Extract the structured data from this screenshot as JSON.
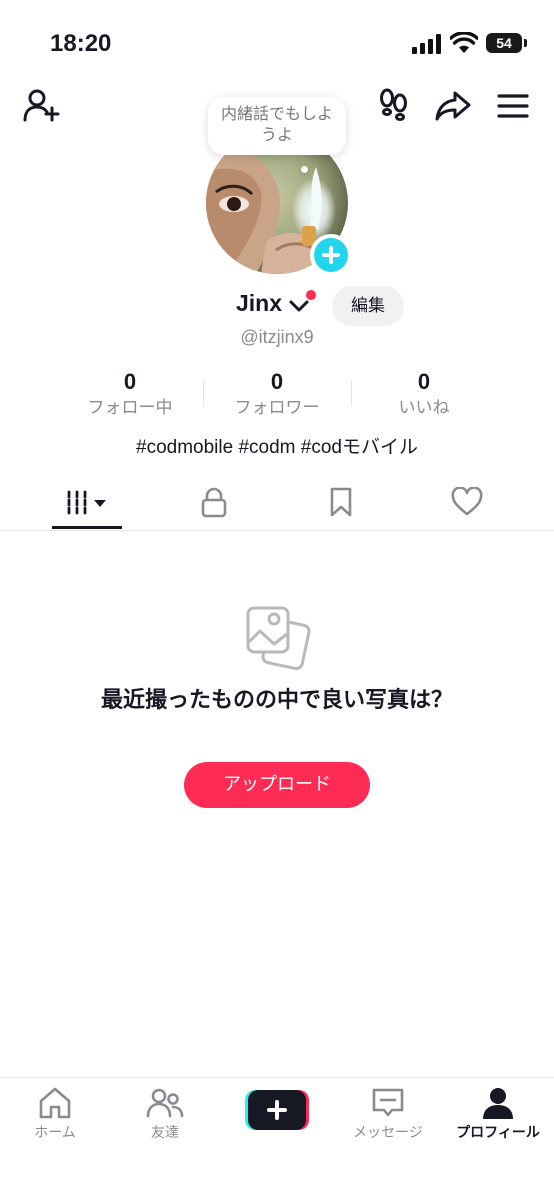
{
  "status_bar": {
    "time": "18:20",
    "battery": "54"
  },
  "header": {
    "note": "内緒話でもしようよ"
  },
  "profile": {
    "display_name": "Jinx",
    "username": "@itzjinx9",
    "edit_label": "編集",
    "bio": "#codmobile #codm #codモバイル"
  },
  "stats": [
    {
      "value": "0",
      "label": "フォロー中"
    },
    {
      "value": "0",
      "label": "フォロワー"
    },
    {
      "value": "0",
      "label": "いいね"
    }
  ],
  "tabs": [
    {
      "name": "videos",
      "icon": "grid-icon",
      "active": true
    },
    {
      "name": "private",
      "icon": "lock-icon"
    },
    {
      "name": "saved",
      "icon": "bookmark-icon"
    },
    {
      "name": "liked",
      "icon": "heart-icon"
    }
  ],
  "empty_state": {
    "title": "最近撮ったものの中で良い写真は？",
    "button_label": "アップロード"
  },
  "bottom_nav": [
    {
      "label": "ホーム",
      "icon": "home-icon"
    },
    {
      "label": "友達",
      "icon": "friends-icon"
    },
    {
      "label": "",
      "icon": "create-icon"
    },
    {
      "label": "メッセージ",
      "icon": "inbox-icon"
    },
    {
      "label": "プロフィール",
      "icon": "profile-icon",
      "active": true
    }
  ],
  "colors": {
    "accent": "#fe2c55",
    "cyan": "#20d5ec",
    "text": "#161823",
    "muted": "#8a8b91"
  }
}
